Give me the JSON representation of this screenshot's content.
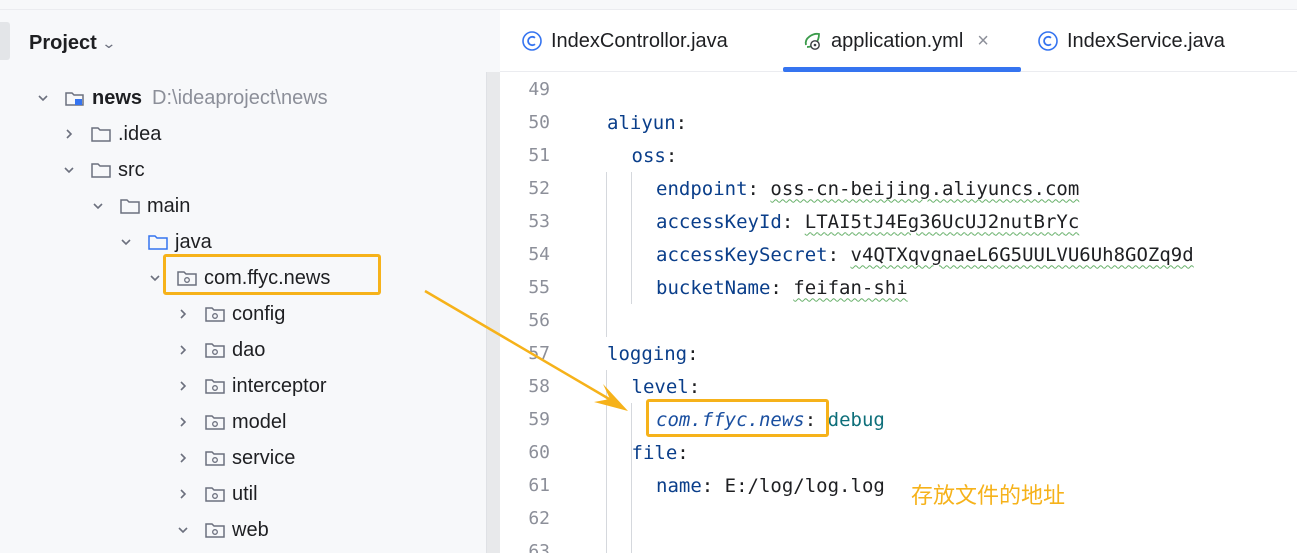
{
  "project_panel": {
    "title": "Project",
    "tree": [
      {
        "label": "news",
        "path": "D:\\ideaproject\\news",
        "expanded": true,
        "icon": "module-folder-icon"
      },
      {
        "label": ".idea",
        "expanded": false,
        "icon": "folder-icon"
      },
      {
        "label": "src",
        "expanded": true,
        "icon": "folder-icon"
      },
      {
        "label": "main",
        "expanded": true,
        "icon": "folder-icon"
      },
      {
        "label": "java",
        "expanded": true,
        "icon": "source-folder-icon"
      },
      {
        "label": "com.ffyc.news",
        "expanded": true,
        "icon": "package-icon"
      },
      {
        "label": "config",
        "expanded": false,
        "icon": "package-icon"
      },
      {
        "label": "dao",
        "expanded": false,
        "icon": "package-icon"
      },
      {
        "label": "interceptor",
        "expanded": false,
        "icon": "package-icon"
      },
      {
        "label": "model",
        "expanded": false,
        "icon": "package-icon"
      },
      {
        "label": "service",
        "expanded": false,
        "icon": "package-icon"
      },
      {
        "label": "util",
        "expanded": false,
        "icon": "package-icon"
      },
      {
        "label": "web",
        "expanded": true,
        "icon": "package-icon"
      }
    ]
  },
  "editor": {
    "tabs": [
      {
        "label": "IndexControllor.java",
        "icon": "java-class-icon",
        "active": false
      },
      {
        "label": "application.yml",
        "icon": "spring-config-icon",
        "active": true,
        "closable": true
      },
      {
        "label": "IndexService.java",
        "icon": "java-class-icon",
        "active": false
      }
    ],
    "lines": [
      {
        "num": "49",
        "key": "",
        "value": ""
      },
      {
        "num": "50",
        "key": "aliyun",
        "sep": ":",
        "value": ""
      },
      {
        "num": "51",
        "key": "oss",
        "sep": ":",
        "value": ""
      },
      {
        "num": "52",
        "key": "endpoint",
        "sep": ":",
        "value": "oss-cn-beijing.aliyuncs.com"
      },
      {
        "num": "53",
        "key": "accessKeyId",
        "sep": ":",
        "value": "LTAI5tJ4Eg36UcUJ2nutBrYc"
      },
      {
        "num": "54",
        "key": "accessKeySecret",
        "sep": ":",
        "value": "v4QTXqvgnaeL6G5UULVU6Uh8GOZq9d"
      },
      {
        "num": "55",
        "key": "bucketName",
        "sep": ":",
        "value": "feifan-shi"
      },
      {
        "num": "56",
        "key": "",
        "value": ""
      },
      {
        "num": "57",
        "key": "logging",
        "sep": ":",
        "value": ""
      },
      {
        "num": "58",
        "key": "level",
        "sep": ":",
        "value": ""
      },
      {
        "num": "59",
        "key": "com.ffyc.news",
        "sep": ":",
        "value": "debug"
      },
      {
        "num": "60",
        "key": "file",
        "sep": ":",
        "value": ""
      },
      {
        "num": "61",
        "key": "name",
        "sep": ":",
        "value": "E:/log/log.log"
      },
      {
        "num": "62",
        "key": "",
        "value": ""
      },
      {
        "num": "63",
        "key": "",
        "value": ""
      }
    ]
  },
  "annotation": {
    "note": "存放文件的地址",
    "color": "#f6b21a"
  },
  "colors": {
    "accent": "#3574f0",
    "highlight": "#f6b21a",
    "key": "#0a3e8a"
  }
}
